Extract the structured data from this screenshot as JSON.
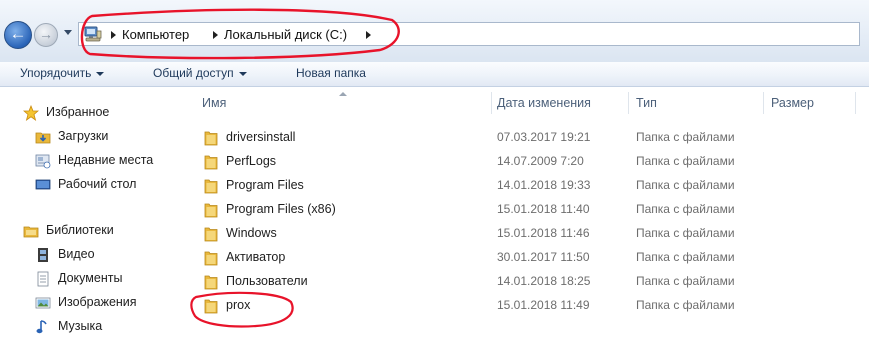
{
  "address_bar": {
    "breadcrumbs": [
      "Компьютер",
      "Локальный диск (C:)"
    ]
  },
  "toolbar": {
    "organize": "Упорядочить",
    "share": "Общий доступ",
    "new_folder": "Новая папка"
  },
  "nav_pane": {
    "favorites": {
      "label": "Избранное",
      "items": [
        "Загрузки",
        "Недавние места",
        "Рабочий стол"
      ]
    },
    "libraries": {
      "label": "Библиотеки",
      "items": [
        "Видео",
        "Документы",
        "Изображения",
        "Музыка"
      ]
    }
  },
  "file_list": {
    "columns": [
      "Имя",
      "Дата изменения",
      "Тип",
      "Размер"
    ],
    "rows": [
      {
        "name": "driversinstall",
        "date": "07.03.2017 19:21",
        "type": "Папка с файлами"
      },
      {
        "name": "PerfLogs",
        "date": "14.07.2009 7:20",
        "type": "Папка с файлами"
      },
      {
        "name": "Program Files",
        "date": "14.01.2018 19:33",
        "type": "Папка с файлами"
      },
      {
        "name": "Program Files (x86)",
        "date": "15.01.2018 11:40",
        "type": "Папка с файлами"
      },
      {
        "name": "Windows",
        "date": "15.01.2018 11:46",
        "type": "Папка с файлами"
      },
      {
        "name": "Активатор",
        "date": "30.01.2017 11:50",
        "type": "Папка с файлами"
      },
      {
        "name": "Пользователи",
        "date": "14.01.2018 18:25",
        "type": "Папка с файлами"
      },
      {
        "name": "prox",
        "date": "15.01.2018 11:49",
        "type": "Папка с файлами"
      }
    ]
  },
  "icons": {
    "back": "back-arrow-icon",
    "forward": "forward-arrow-icon",
    "computer": "computer-icon",
    "folder": "folder-icon",
    "favorites": "star-icon",
    "libraries": "library-icon"
  },
  "colors": {
    "annotation": "#e8132a",
    "toolbar_text": "#1e395b",
    "folder": "#e9b83c"
  }
}
